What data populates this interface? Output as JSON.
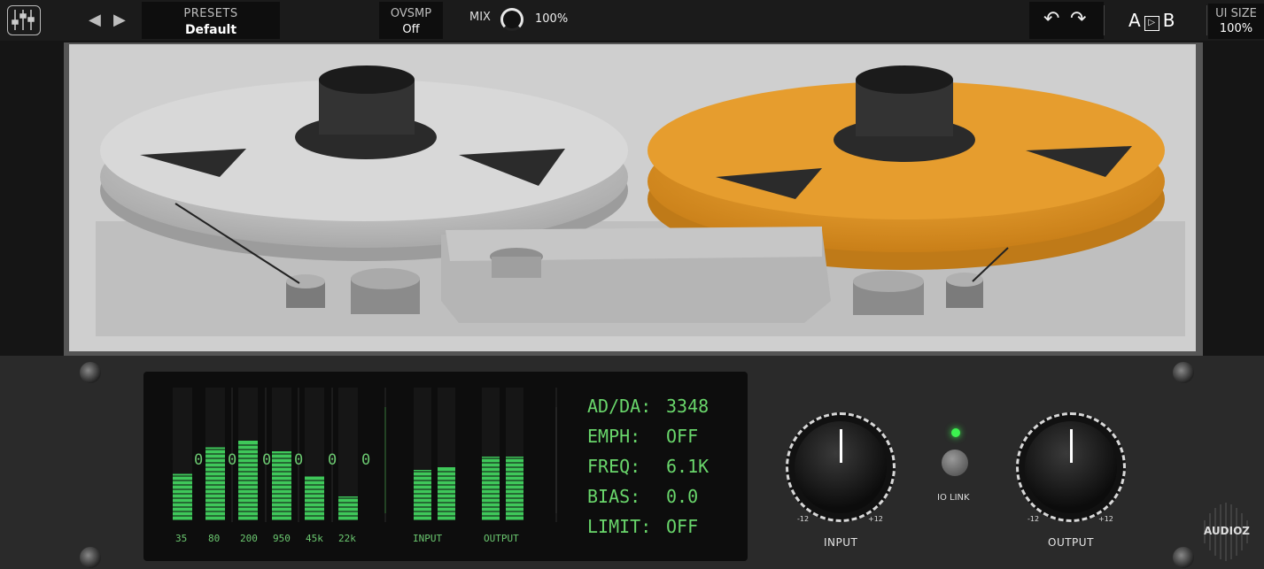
{
  "topbar": {
    "presets_label": "PRESETS",
    "preset_value": "Default",
    "ovsmp_label": "OVSMP",
    "ovsmp_value": "Off",
    "mix_label": "MIX",
    "mix_value": "100%",
    "ab_a": "A",
    "ab_arrow": "▷",
    "ab_b": "B",
    "uisize_label": "UI SIZE",
    "uisize_value": "100%"
  },
  "meters": {
    "band_labels": [
      "35",
      "80",
      "200",
      "950",
      "45k",
      "22k"
    ],
    "peak_marks": [
      "0",
      "0",
      "0",
      "0",
      "0",
      "0",
      "0"
    ],
    "input_label": "INPUT",
    "output_label": "OUTPUT",
    "band_levels": [
      0.35,
      0.55,
      0.6,
      0.52,
      0.33,
      0.18
    ],
    "io_levels": [
      0.38,
      0.4,
      0.48,
      0.48
    ]
  },
  "readout": [
    {
      "key": "AD/DA:",
      "value": "3348"
    },
    {
      "key": "EMPH:",
      "value": "OFF"
    },
    {
      "key": "FREQ:",
      "value": "6.1K"
    },
    {
      "key": "BIAS:",
      "value": "0.0"
    },
    {
      "key": "LIMIT:",
      "value": "OFF"
    }
  ],
  "controls": {
    "input_label": "INPUT",
    "output_label": "OUTPUT",
    "min_label": "-12",
    "max_label": "+12",
    "io_link_label": "IO LINK"
  },
  "watermark": "AUDIOZ",
  "colors": {
    "accent": "#69d66b",
    "reel_orange": "#e39a2a",
    "reel_silver": "#c9c9c9"
  }
}
